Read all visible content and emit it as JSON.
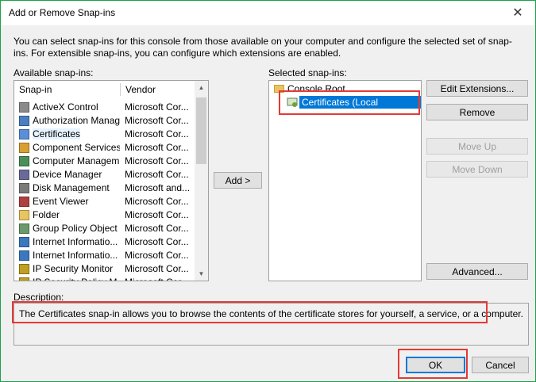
{
  "window": {
    "title": "Add or Remove Snap-ins",
    "close_glyph": "✕"
  },
  "intro": "You can select snap-ins for this console from those available on your computer and configure the selected set of snap-ins. For extensible snap-ins, you can configure which extensions are enabled.",
  "available": {
    "label": "Available snap-ins:",
    "columns": {
      "snapin": "Snap-in",
      "vendor": "Vendor"
    },
    "items": [
      {
        "name": "ActiveX Control",
        "vendor": "Microsoft Cor..."
      },
      {
        "name": "Authorization Manager",
        "vendor": "Microsoft Cor..."
      },
      {
        "name": "Certificates",
        "vendor": "Microsoft Cor..."
      },
      {
        "name": "Component Services",
        "vendor": "Microsoft Cor..."
      },
      {
        "name": "Computer Managem...",
        "vendor": "Microsoft Cor..."
      },
      {
        "name": "Device Manager",
        "vendor": "Microsoft Cor..."
      },
      {
        "name": "Disk Management",
        "vendor": "Microsoft and..."
      },
      {
        "name": "Event Viewer",
        "vendor": "Microsoft Cor..."
      },
      {
        "name": "Folder",
        "vendor": "Microsoft Cor..."
      },
      {
        "name": "Group Policy Object ...",
        "vendor": "Microsoft Cor..."
      },
      {
        "name": "Internet Informatio...",
        "vendor": "Microsoft Cor..."
      },
      {
        "name": "Internet Informatio...",
        "vendor": "Microsoft Cor..."
      },
      {
        "name": "IP Security Monitor",
        "vendor": "Microsoft Cor..."
      },
      {
        "name": "IP Security Policy M...",
        "vendor": "Microsoft Cor..."
      }
    ]
  },
  "add_button": "Add >",
  "selected": {
    "label": "Selected snap-ins:",
    "root": "Console Root",
    "child": "Certificates (Local Computer)"
  },
  "side_buttons": {
    "edit_extensions": "Edit Extensions...",
    "remove": "Remove",
    "move_up": "Move Up",
    "move_down": "Move Down",
    "advanced": "Advanced..."
  },
  "description": {
    "label": "Description:",
    "text": "The Certificates snap-in allows you to browse the contents of the certificate stores for yourself, a service, or a computer."
  },
  "footer": {
    "ok": "OK",
    "cancel": "Cancel"
  },
  "colors": {
    "window_border": "#1aa34a",
    "highlight": "#e53935",
    "selection": "#0078d7"
  }
}
